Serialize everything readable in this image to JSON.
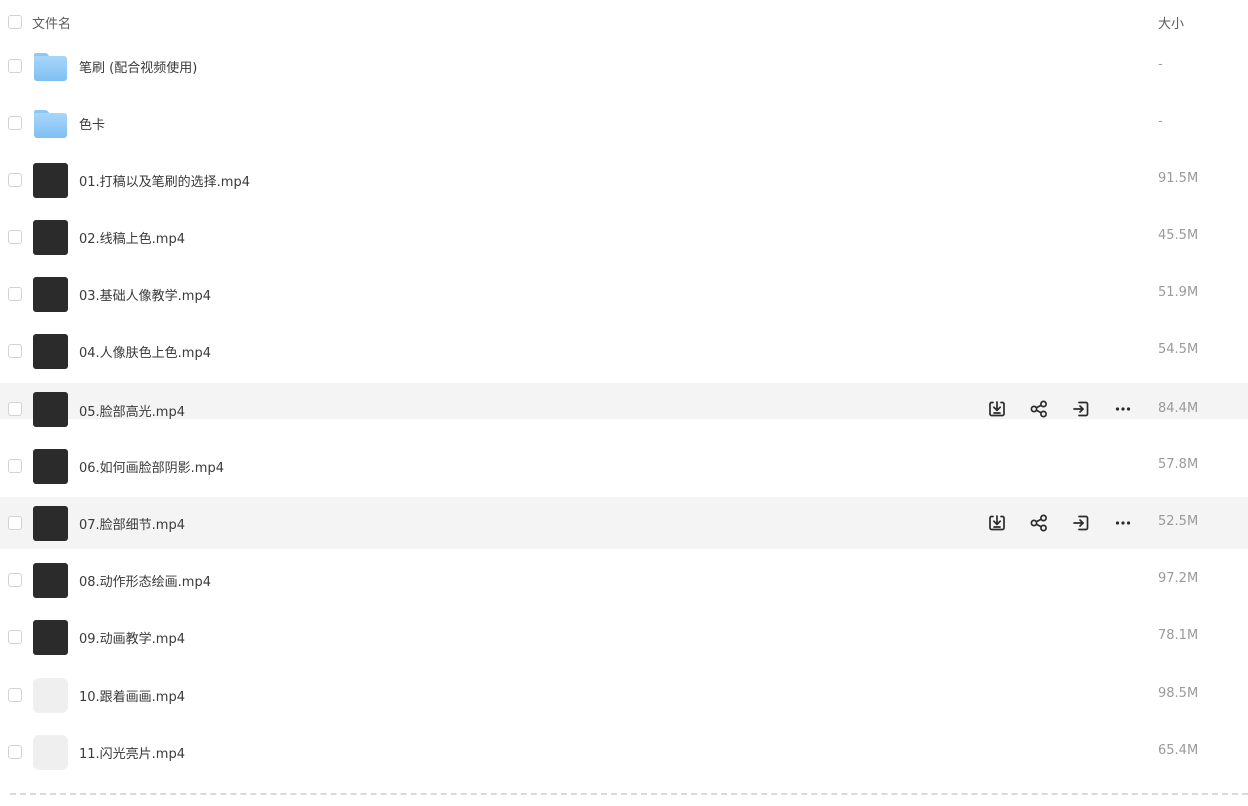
{
  "header": {
    "name_label": "文件名",
    "size_label": "大小"
  },
  "files": [
    {
      "name": "笔刷 (配合视频使用)",
      "size": "-",
      "type": "folder"
    },
    {
      "name": "色卡",
      "size": "-",
      "type": "folder"
    },
    {
      "name": "01.打稿以及笔刷的选择.mp4",
      "size": "91.5M",
      "type": "video"
    },
    {
      "name": "02.线稿上色.mp4",
      "size": "45.5M",
      "type": "video"
    },
    {
      "name": "03.基础人像教学.mp4",
      "size": "51.9M",
      "type": "video"
    },
    {
      "name": "04.人像肤色上色.mp4",
      "size": "54.5M",
      "type": "video"
    },
    {
      "name": "05.脸部高光.mp4",
      "size": "84.4M",
      "type": "video"
    },
    {
      "name": "06.如何画脸部阴影.mp4",
      "size": "57.8M",
      "type": "video"
    },
    {
      "name": "07.脸部细节.mp4",
      "size": "52.5M",
      "type": "video"
    },
    {
      "name": "08.动作形态绘画.mp4",
      "size": "97.2M",
      "type": "video"
    },
    {
      "name": "09.动画教学.mp4",
      "size": "78.1M",
      "type": "video"
    },
    {
      "name": "10.跟着画画.mp4",
      "size": "98.5M",
      "type": "video"
    },
    {
      "name": "11.闪光亮片.mp4",
      "size": "65.4M",
      "type": "video"
    }
  ],
  "row_actions": [
    "download-icon",
    "share-icon",
    "move-icon",
    "more-icon"
  ]
}
